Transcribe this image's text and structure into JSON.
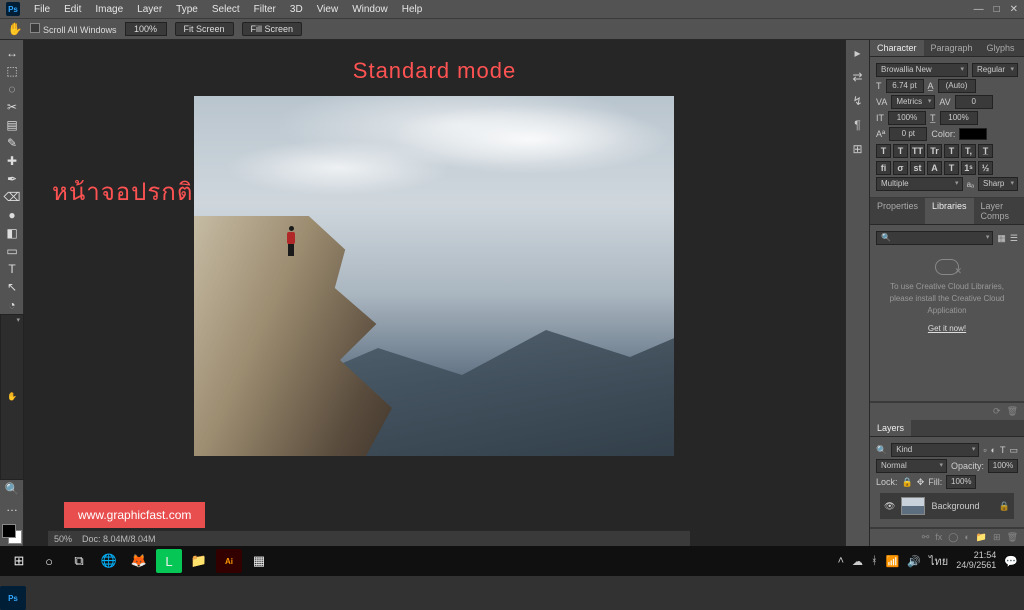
{
  "menu": {
    "items": [
      "File",
      "Edit",
      "Image",
      "Layer",
      "Type",
      "Select",
      "Filter",
      "3D",
      "View",
      "Window",
      "Help"
    ]
  },
  "window_controls": {
    "min": "—",
    "max": "□",
    "close": "✕"
  },
  "optionsbar": {
    "scroll_label": "Scroll All Windows",
    "zoom": "100%",
    "fit_screen": "Fit Screen",
    "fill_screen": "Fill Screen"
  },
  "tools": [
    "↔",
    "⬚",
    "◌",
    "✂",
    "▤",
    "✎",
    "✚",
    "✒",
    "⌫",
    "●",
    "◧",
    "▭",
    "↖",
    "🔍",
    "✋",
    "T",
    "◔",
    "…"
  ],
  "overlay": {
    "title": "Standard mode",
    "thai": "หน้าจอปรกติ",
    "site": "www.graphicfast.com"
  },
  "right_strip": [
    "▸",
    "⇄",
    "↯",
    "¶",
    "⊞"
  ],
  "character": {
    "tabs": [
      "Character",
      "Paragraph",
      "Glyphs"
    ],
    "font": "Browallia New",
    "style": "Regular",
    "size": "6.74 pt",
    "leading": "(Auto)",
    "tracking": "Metrics",
    "kerning": "0",
    "vscale": "100%",
    "hscale": "100%",
    "baseline": "0 pt",
    "color_label": "Color:",
    "lang": "Multiple",
    "aa": "Sharp",
    "t_buttons": [
      "T",
      "T",
      "TT",
      "Tr",
      "T",
      "T,",
      "T̲"
    ]
  },
  "libraries": {
    "tabs": [
      "Properties",
      "Libraries",
      "Layer Comps"
    ],
    "msg1": "To use Creative Cloud Libraries,",
    "msg2": "please install the Creative Cloud",
    "msg3": "Application",
    "cta": "Get it now!"
  },
  "layers": {
    "title": "Layers",
    "kind": "Kind",
    "blend": "Normal",
    "opacity_label": "Opacity:",
    "opacity": "100%",
    "lock_label": "Lock:",
    "fill_label": "Fill:",
    "fill": "100%",
    "layer_name": "Background"
  },
  "statusbar": {
    "zoom": "50%",
    "doc": "Doc: 8.04M/8.04M"
  },
  "taskbar": {
    "time": "21:54",
    "date": "24/9/2561",
    "lang": "ไทย"
  }
}
